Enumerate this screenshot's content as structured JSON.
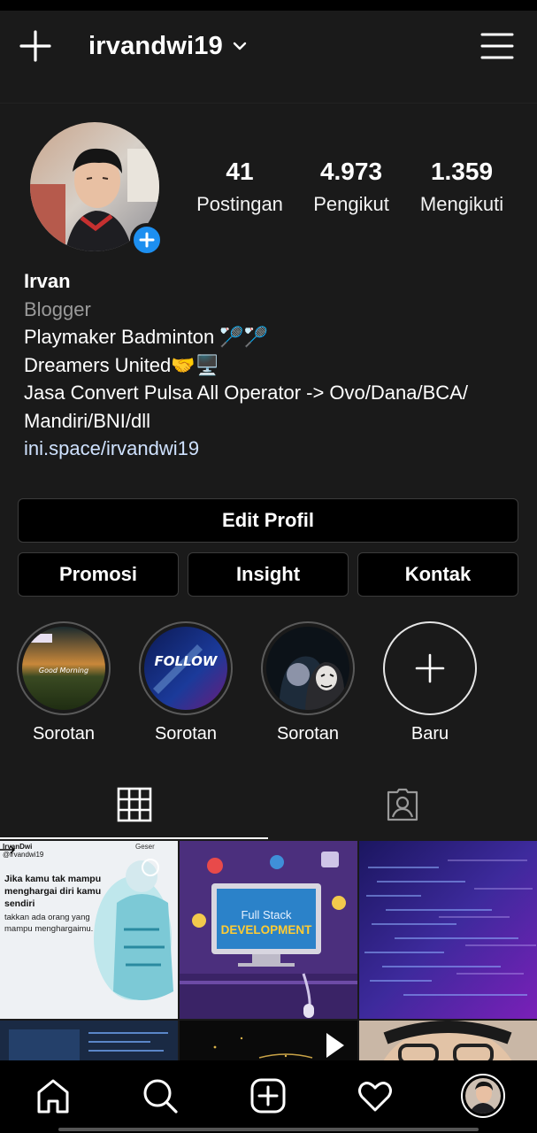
{
  "header": {
    "username": "irvandwi19",
    "icons": {
      "create": "plus-icon",
      "account_switch": "chevron-down-icon",
      "menu": "hamburger-menu-icon"
    }
  },
  "profile": {
    "stats": [
      {
        "value": "41",
        "label": "Postingan"
      },
      {
        "value": "4.973",
        "label": "Pengikut"
      },
      {
        "value": "1.359",
        "label": "Mengikuti"
      }
    ]
  },
  "bio": {
    "name": "Irvan",
    "category": "Blogger",
    "lines": [
      "Playmaker Badminton 🏸🏸",
      "Dreamers United🤝🖥️",
      "Jasa Convert Pulsa All Operator -> Ovo/Dana/BCA/",
      "Mandiri/BNI/dll"
    ],
    "link": "ini.space/irvandwi19"
  },
  "actions": {
    "edit_profile": "Edit Profil",
    "promote": "Promosi",
    "insights": "Insight",
    "contact": "Kontak"
  },
  "highlights": [
    {
      "label": "Sorotan",
      "overlay_text": "Good Morning"
    },
    {
      "label": "Sorotan",
      "overlay_text": "FOLLOW"
    },
    {
      "label": "Sorotan",
      "overlay_text": ""
    },
    {
      "label": "Baru"
    }
  ],
  "tabs": {
    "active": "grid",
    "icons": [
      "grid-icon",
      "tagged-person-icon"
    ]
  },
  "posts": {
    "p1": {
      "brand": "IrvanDwi",
      "handle": "@irvandwi19",
      "swipe": "Geser",
      "headline": "Jika kamu tak mampu menghargai diri kamu sendiri",
      "subtext": "takkan ada orang yang mampu menghargaimu."
    },
    "p2": {
      "title_top": "Full Stack",
      "title_bottom": "DEVELOPMENT"
    }
  },
  "bottom_nav": [
    "home-icon",
    "search-icon",
    "create-post-icon",
    "activity-heart-icon",
    "profile-avatar"
  ],
  "colors": {
    "background": "#1a1a1a",
    "accent_blue": "#1d8ff0",
    "link": "#cfe2ff"
  }
}
